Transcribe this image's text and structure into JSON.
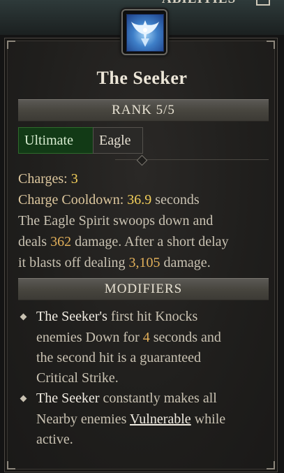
{
  "top": {
    "label": "ABILITIES"
  },
  "skill": {
    "name": "The Seeker",
    "rank": "RANK 5/5",
    "tags": [
      "Ultimate",
      "Eagle"
    ]
  },
  "stats": {
    "charges_label": "Charges:",
    "charges_value": "3",
    "cooldown_label": "Charge Cooldown:",
    "cooldown_value": "36.9",
    "cooldown_unit": "seconds"
  },
  "description": {
    "l1": "The Eagle Spirit swoops down and",
    "l2_a": "deals ",
    "l2_num": "362",
    "l2_b": " damage. After a short delay",
    "l3_a": "it blasts off dealing ",
    "l3_num": "3,105",
    "l3_b": " damage."
  },
  "modifiers": {
    "header": "MODIFIERS",
    "m1": {
      "l1_name": "The Seeker's",
      "l1_rest": " first hit Knocks",
      "l2_a": "enemies Down for ",
      "l2_num": "4",
      "l2_b": " seconds and",
      "l3": "the second hit is a guaranteed",
      "l4": "Critical Strike."
    },
    "m2": {
      "l1_name": "The Seeker",
      "l1_rest": " constantly makes all",
      "l2_a": "Nearby enemies ",
      "l2_link": "Vulnerable",
      "l2_b": " while",
      "l3": "active."
    }
  },
  "colors": {
    "highlight_number": "#f3cf5a",
    "ultimate_tag_bg": "#123a16",
    "icon_blue": "#3e7fc8"
  },
  "icons": [
    "eagle-spirit-icon",
    "bullet-diamond-icon"
  ]
}
